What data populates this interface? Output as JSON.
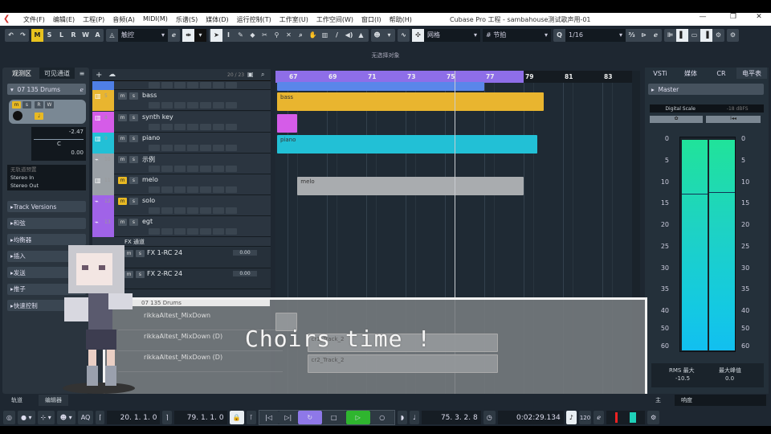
{
  "menu": {
    "items": [
      "文件(F)",
      "编辑(E)",
      "工程(P)",
      "音频(A)",
      "MIDI(M)",
      "乐谱(S)",
      "媒体(D)",
      "运行控制(T)",
      "工作室(U)",
      "工作空间(W)",
      "窗口(I)",
      "帮助(H)"
    ],
    "title": "Cubase Pro 工程 - sambahouse测试歌声用-01"
  },
  "toolbar": {
    "modes": [
      "M",
      "S",
      "L",
      "R",
      "W",
      "A"
    ],
    "automation_mode": "触控",
    "snap_type": "网格",
    "grid_type": "节拍",
    "quantize": "1/16"
  },
  "info": "无选择对象",
  "inspector": {
    "tabs": [
      "观测区",
      "可见通道"
    ],
    "track_name": "07 135 Drums",
    "volume": "-2.47",
    "pan": "C",
    "delay": "0.00",
    "preset": "无轨道预置",
    "input": "Stereo In",
    "output": "Stereo Out",
    "sections": [
      "Track Versions",
      "和弦",
      "均衡器",
      "插入",
      "发送",
      "推子",
      "快速控制"
    ]
  },
  "tracklist": {
    "count": "20 / 23",
    "tracks": [
      {
        "num": "",
        "name": "",
        "color": "#4f7fe6",
        "type": "midi"
      },
      {
        "num": "5",
        "name": "bass",
        "color": "#e9b52f",
        "type": "midi"
      },
      {
        "num": "8",
        "name": "synth key",
        "color": "#d55ce8",
        "type": "midi"
      },
      {
        "num": "9",
        "name": "piano",
        "color": "#22c0d6",
        "type": "midi"
      },
      {
        "num": "10",
        "name": "示例",
        "color": "#9aa0a6",
        "type": "audio"
      },
      {
        "num": "11",
        "name": "melo",
        "color": "#9aa0a6",
        "type": "midi",
        "muted": true
      },
      {
        "num": "12",
        "name": "solo",
        "color": "#a063e8",
        "type": "audio",
        "muted": true
      },
      {
        "num": "13",
        "name": "egt",
        "color": "#a063e8",
        "type": "audio"
      }
    ],
    "fx_folder": "FX 通道",
    "fx": [
      {
        "num": "14",
        "name": "FX 1-RC 24",
        "value": "0.00"
      },
      {
        "num": "15",
        "name": "FX 2-RC 24",
        "value": "0.00"
      }
    ],
    "drums_folder": "07 135 Drums",
    "overlay_tracks": [
      "rikkaAltest_MixDown",
      "rikkaAltest_MixDown (D)",
      "rikkaAltest_MixDown (D)"
    ]
  },
  "timeline": {
    "bars": [
      "67",
      "69",
      "71",
      "73",
      "75",
      "77",
      "79",
      "81",
      "83"
    ],
    "cycle_end_bar": 79,
    "playhead_bar": 75.5,
    "clips": [
      {
        "row": 0,
        "label": "",
        "start": 66.4,
        "end": 77,
        "color": "#5a86ea"
      },
      {
        "row": 1,
        "label": "bass",
        "start": 66.4,
        "end": 80,
        "color": "#e9b52f"
      },
      {
        "row": 2,
        "label": "",
        "start": 66.4,
        "end": 67.5,
        "color": "#d55ce8"
      },
      {
        "row": 3,
        "label": "piano",
        "start": 66.4,
        "end": 79.7,
        "color": "#22c0d6"
      },
      {
        "row": 5,
        "label": "melo",
        "start": 67.5,
        "end": 79,
        "color": "#a9acaf"
      }
    ],
    "overlay_clips": [
      {
        "row": 0,
        "label": "",
        "start": 66.4,
        "end": 67.5
      },
      {
        "row": 1,
        "label": "cr1_Track_2",
        "start": 68,
        "end": 77.7
      },
      {
        "row": 2,
        "label": "cr2_Track_2",
        "start": 68,
        "end": 77.7
      }
    ]
  },
  "caption": "Choirs time !",
  "rightpanel": {
    "tabs": [
      "VSTi",
      "媒体",
      "CR",
      "电平表"
    ],
    "master": "Master",
    "scale": "Digital Scale",
    "scale_value": "-18 dBFS",
    "ticks": [
      "0",
      "5",
      "10",
      "15",
      "20",
      "25",
      "30",
      "35",
      "40",
      "50",
      "60"
    ],
    "rms_label": "RMS 最大",
    "rms": "-10.5",
    "peak_label": "最大峰值",
    "peak": "0.0",
    "level_left_db": 12.5,
    "level_right_db": 12.2
  },
  "bottomtabs": {
    "left": [
      "轨道",
      "编辑器"
    ],
    "right": [
      "主",
      "响度"
    ]
  },
  "transport": {
    "left_locator": "20. 1. 1.   0",
    "right_locator": "79. 1. 1.   0",
    "position": "75. 3. 2.   8",
    "time": "0:02:29.134",
    "tempo": "120",
    "aq": "AQ"
  }
}
